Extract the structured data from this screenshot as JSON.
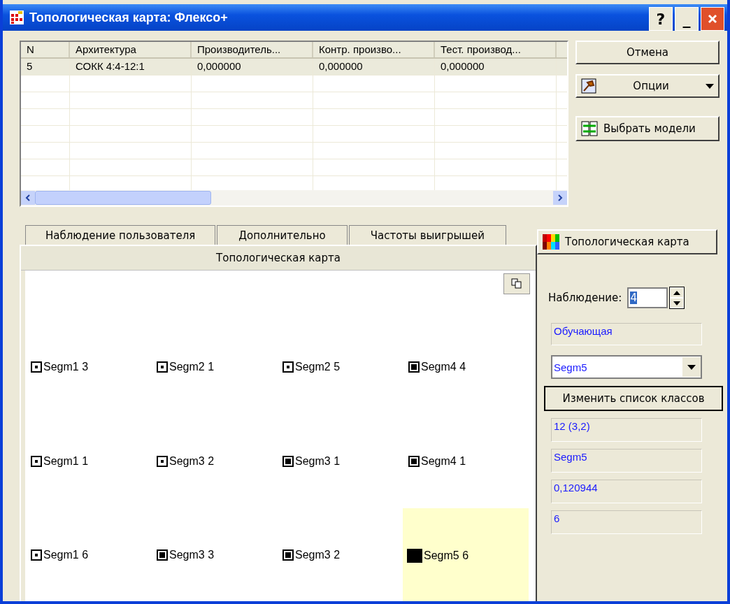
{
  "window": {
    "title": "Топологическая карта: Флексо+"
  },
  "title_buttons": [
    "?",
    "_"
  ],
  "table": {
    "columns": [
      "N",
      "Архитектура",
      "Производитель...",
      "Контр. произво...",
      "Тест. производ..."
    ],
    "rows": [
      {
        "cells": [
          "5",
          "СОКК 4:4-12:1",
          "0,000000",
          "0,000000",
          "0,000000"
        ],
        "selected": true
      }
    ]
  },
  "side_buttons": [
    {
      "label": "Отмена",
      "kind": "plain"
    },
    {
      "label": "Опции",
      "kind": "dropdown"
    },
    {
      "label": "Выбрать модели",
      "kind": "models"
    }
  ],
  "tabs": [
    {
      "label": "Наблюдение пользователя",
      "selected": false
    },
    {
      "label": "Дополнительно",
      "selected": false
    },
    {
      "label": "Частоты выигрышей",
      "selected": false
    }
  ],
  "map_panel": {
    "header": "Топологическая карта",
    "cells": [
      {
        "label": "Segm1 3",
        "kind": "dot",
        "selected": false
      },
      {
        "label": "Segm2 1",
        "kind": "dot",
        "selected": false
      },
      {
        "label": "Segm2 5",
        "kind": "dot",
        "selected": false
      },
      {
        "label": "Segm4 4",
        "kind": "square",
        "selected": false
      },
      {
        "label": "Segm1 1",
        "kind": "dot",
        "selected": false
      },
      {
        "label": "Segm3 2",
        "kind": "dot",
        "selected": false
      },
      {
        "label": "Segm3 1",
        "kind": "square",
        "selected": false
      },
      {
        "label": "Segm4 1",
        "kind": "square",
        "selected": false
      },
      {
        "label": "Segm1 6",
        "kind": "dot",
        "selected": false
      },
      {
        "label": "Segm3 3",
        "kind": "square",
        "selected": false
      },
      {
        "label": "Segm3 2",
        "kind": "square",
        "selected": false
      },
      {
        "label": "Segm5 6",
        "kind": "solid",
        "selected": true
      }
    ]
  },
  "right_panel": {
    "map_button": "Топологическая карта",
    "observation_label": "Наблюдение:",
    "observation_value": "4",
    "set_type": "Обучающая",
    "class_select": "Segm5",
    "change_classes_button": "Изменить список классов",
    "info": [
      "12 (3,2)",
      "Segm5",
      "0,120944",
      "6"
    ]
  }
}
